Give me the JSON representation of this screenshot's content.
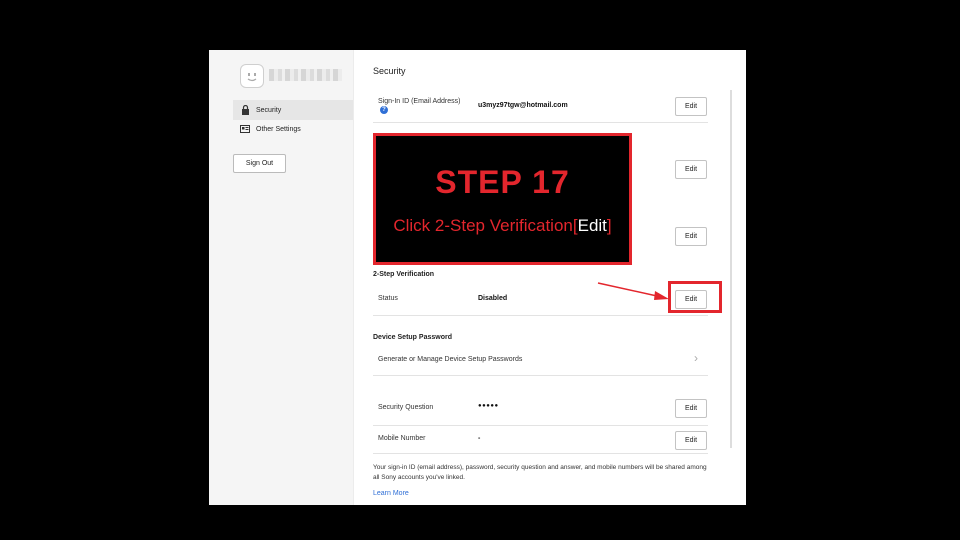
{
  "sidebar": {
    "items": [
      {
        "label": "Security",
        "icon": "lock-icon"
      },
      {
        "label": "Other Settings",
        "icon": "id-card-icon"
      }
    ],
    "sign_out": "Sign Out"
  },
  "main": {
    "title": "Security",
    "signin": {
      "label": "Sign-In ID (Email Address)",
      "value": "u3myz97tgw@hotmail.com",
      "help": "?",
      "button": "Edit"
    },
    "hidden_row_buttons": [
      "Edit",
      "Edit"
    ],
    "two_step": {
      "heading": "2-Step Verification",
      "label": "Status",
      "value": "Disabled",
      "button": "Edit"
    },
    "device": {
      "heading": "Device Setup Password",
      "label": "Generate or Manage Device Setup Passwords",
      "chevron": "›"
    },
    "security_question": {
      "label": "Security Question",
      "value": "●●●●●",
      "button": "Edit"
    },
    "mobile": {
      "label": "Mobile Number",
      "value": "-",
      "button": "Edit"
    },
    "footnote": "Your sign-in ID (email address), password, security question and answer, and mobile numbers will be shared among all Sony accounts you've linked.",
    "learn_more": "Learn More"
  },
  "overlay": {
    "title": "STEP 17",
    "instruction_prefix": "Click 2-Step Verification",
    "instruction_open": "[",
    "instruction_highlight": "Edit",
    "instruction_close": "]"
  },
  "colors": {
    "accent_red": "#e3262d",
    "link_blue": "#2f6fd6"
  }
}
